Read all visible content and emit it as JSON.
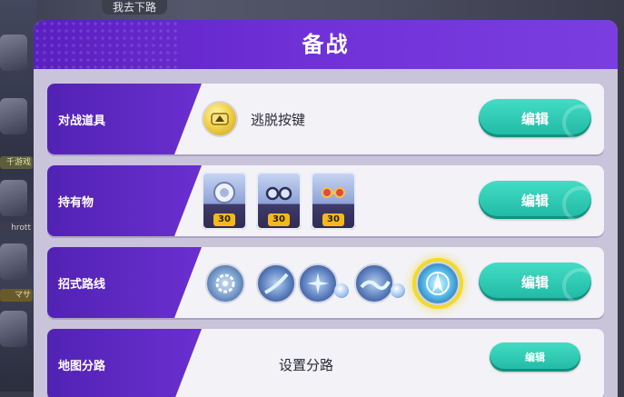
{
  "background": {
    "speech_bubble": "我去下路",
    "side_chip_1": "千游戏",
    "side_chip_2": "hrott",
    "side_chip_3": "マサ"
  },
  "panel": {
    "title": "备战"
  },
  "rows": [
    {
      "label": "对战道具",
      "item_name": "逃脱按键",
      "icon": "eject-button-icon",
      "button": "编辑"
    },
    {
      "label": "持有物",
      "held_items": [
        {
          "icon": "scope-lens-icon",
          "level": "30"
        },
        {
          "icon": "glasses-icon",
          "level": "30"
        },
        {
          "icon": "muscle-band-icon",
          "level": "30"
        }
      ],
      "button": "编辑"
    },
    {
      "label": "招式路线",
      "moves": [
        {
          "icon": "gear-move-icon",
          "selected": false
        },
        {
          "icon": "slash-move-icon",
          "selected": false
        },
        {
          "icon": "burst-move-icon",
          "selected": false
        },
        {
          "icon": "wave-move-icon",
          "selected": false
        },
        {
          "icon": "unite-move-icon",
          "selected": true
        }
      ],
      "button": "编辑"
    },
    {
      "label": "地图分路",
      "value": "设置分路",
      "button": "编辑"
    }
  ],
  "colors": {
    "header_purple": "#6a2fd0",
    "label_purple": "#5222b4",
    "button_teal": "#26c2ad",
    "level_badge": "#f4b81b",
    "selected_glow": "#f3d92a"
  }
}
